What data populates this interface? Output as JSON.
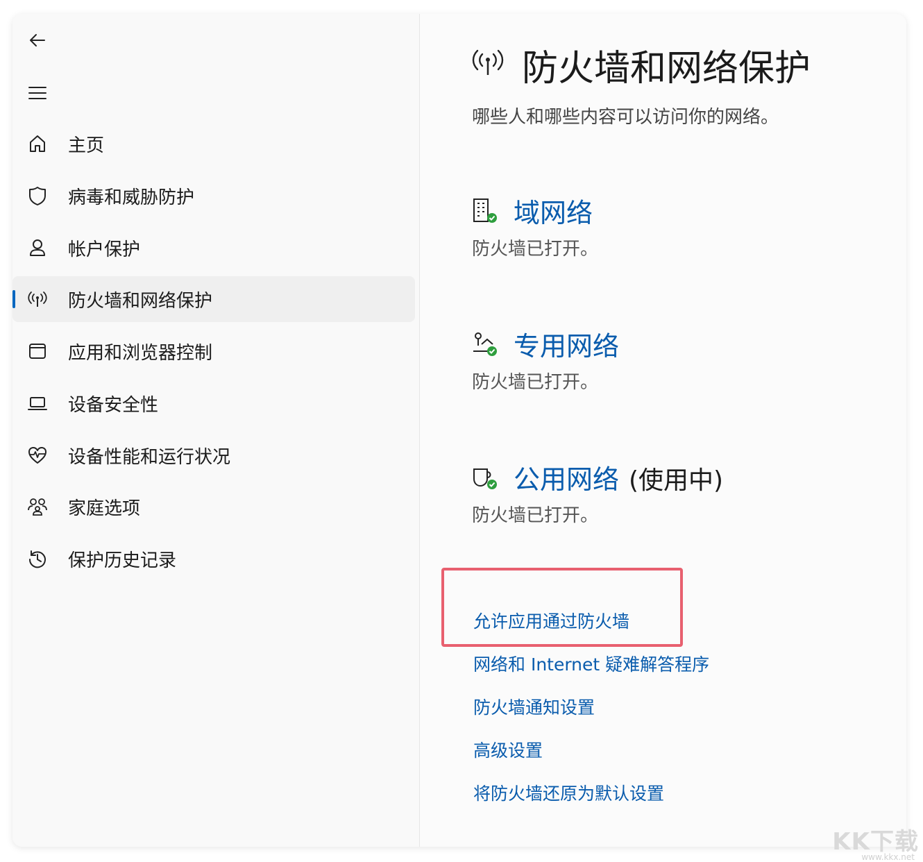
{
  "sidebar": {
    "items": [
      {
        "label": "主页",
        "icon": "home-icon"
      },
      {
        "label": "病毒和威胁防护",
        "icon": "shield-icon"
      },
      {
        "label": "帐户保护",
        "icon": "account-icon"
      },
      {
        "label": "防火墙和网络保护",
        "icon": "antenna-icon",
        "selected": true
      },
      {
        "label": "应用和浏览器控制",
        "icon": "app-window-icon"
      },
      {
        "label": "设备安全性",
        "icon": "laptop-icon"
      },
      {
        "label": "设备性能和运行状况",
        "icon": "heart-pulse-icon"
      },
      {
        "label": "家庭选项",
        "icon": "family-icon"
      },
      {
        "label": "保护历史记录",
        "icon": "history-icon"
      }
    ]
  },
  "main": {
    "title": "防火墙和网络保护",
    "subtitle": "哪些人和哪些内容可以访问你的网络。",
    "networks": [
      {
        "name": "域网络",
        "suffix": "",
        "status": "防火墙已打开。",
        "icon": "domain-network-icon"
      },
      {
        "name": "专用网络",
        "suffix": "",
        "status": "防火墙已打开。",
        "icon": "private-network-icon"
      },
      {
        "name": "公用网络",
        "suffix": "(使用中)",
        "status": "防火墙已打开。",
        "icon": "public-network-icon"
      }
    ],
    "links": [
      "允许应用通过防火墙",
      "网络和 Internet 疑难解答程序",
      "防火墙通知设置",
      "高级设置",
      "将防火墙还原为默认设置"
    ]
  },
  "watermark": {
    "text": "KK下载",
    "sub": "www.kkx.net"
  },
  "colors": {
    "accent": "#0067c0",
    "link": "#0a5cad",
    "highlight": "#e8606f",
    "ok_badge": "#2e9e3e"
  }
}
